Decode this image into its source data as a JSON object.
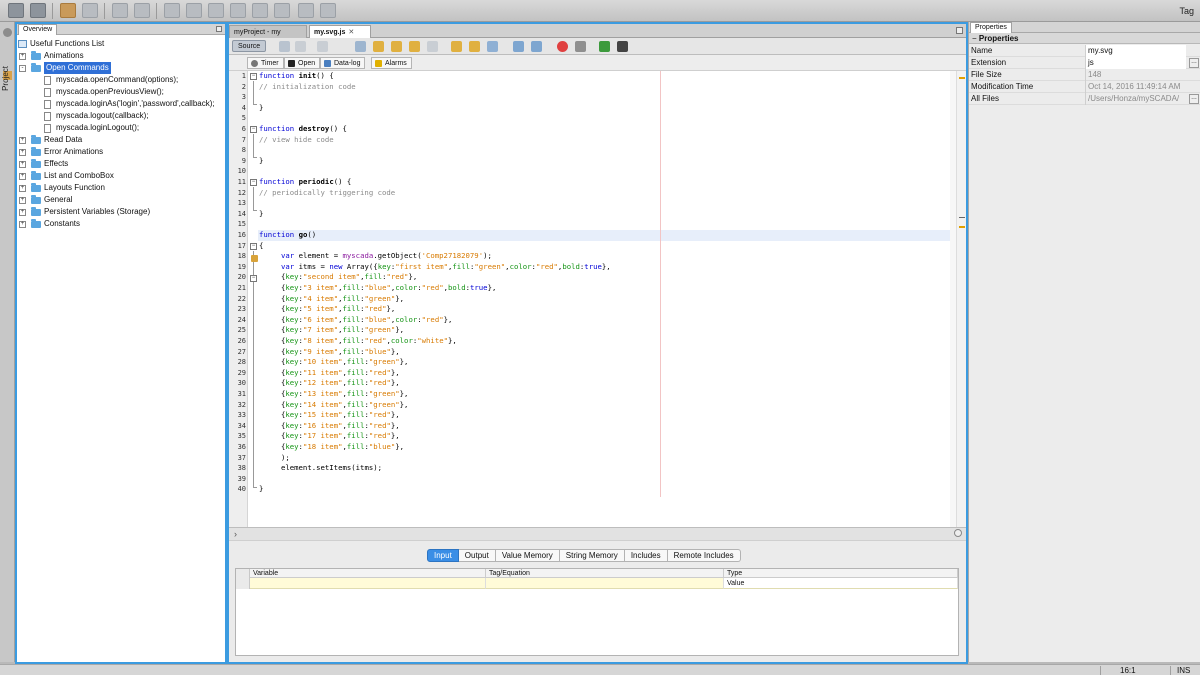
{
  "toolbar": {
    "tag_label": "Tag",
    "icons": [
      "save-icon",
      "save-all-icon",
      "undo-icon",
      "redo-icon",
      "copy-page-icon",
      "delete-page-icon",
      "screen-icon",
      "screen-add-icon",
      "screen-move-icon",
      "screen-remove-icon",
      "screen-copy-icon",
      "screen-export-icon",
      "print-icon",
      "download-icon"
    ]
  },
  "left_strip": {
    "project_label": "Project"
  },
  "overview": {
    "tab_label": "Overview",
    "root": "Useful Functions List",
    "items": [
      {
        "label": "Animations",
        "expander": "+"
      },
      {
        "label": "Open Commands",
        "expander": "-"
      },
      {
        "label": "Read Data",
        "expander": "+"
      },
      {
        "label": "Error Animations",
        "expander": "+"
      },
      {
        "label": "Effects",
        "expander": "+"
      },
      {
        "label": "List and ComboBox",
        "expander": "+"
      },
      {
        "label": "Layouts Function",
        "expander": "+"
      },
      {
        "label": "General",
        "expander": "+"
      },
      {
        "label": "Persistent Variables (Storage)",
        "expander": "+"
      },
      {
        "label": "Constants",
        "expander": "+"
      }
    ],
    "open_commands_children": [
      "myscada.openCommand(options);",
      "myscada.openPreviousView();",
      "myscada.loginAs('login','password',callback);",
      "myscada.logout(callback);",
      "myscada.loginLogout();"
    ]
  },
  "editor": {
    "tabs": [
      {
        "label": "myProject - my"
      },
      {
        "label": "my.svg.js",
        "close": "✕"
      }
    ],
    "source_label": "Source",
    "sub_buttons": [
      "Timer",
      "Open",
      "Data-log",
      "Alarms"
    ],
    "line_numbers": [
      "1",
      "2",
      "3",
      "4",
      "5",
      "6",
      "7",
      "8",
      "9",
      "10",
      "11",
      "12",
      "13",
      "14",
      "15",
      "16",
      "17",
      "18",
      "19",
      "20",
      "21",
      "22",
      "23",
      "24",
      "25",
      "26",
      "27",
      "28",
      "29",
      "30",
      "31",
      "32",
      "33",
      "34",
      "35",
      "36",
      "37",
      "38",
      "39",
      "40"
    ],
    "code": {
      "l1_kw": "function",
      "l1_fn": "init",
      "l1_rest": "() {",
      "l2": "// initialization code",
      "l4": "}",
      "l6_kw": "function",
      "l6_fn": "destroy",
      "l6_rest": "() {",
      "l7": "// view hide code",
      "l9": "}",
      "l11_kw": "function",
      "l11_fn": "periodic",
      "l11_rest": "() {",
      "l12": "// periodically triggering code",
      "l14": "}",
      "l16_kw": "function",
      "l16_fn": "go",
      "l16_rest": "()",
      "l17": "{",
      "l18_kw": "var",
      "l18_a": "element = ",
      "l18_obj": "myscada",
      "l18_b": ".getObject(",
      "l18_str": "'Comp27182079'",
      "l18_c": ");",
      "l19_kw": "var",
      "l19_a": "itms = ",
      "l19_new": "new",
      "l19_b": "Array({",
      "l19_k1": "key",
      "l19_v1": "\"first item\"",
      "l19_k2": "fill",
      "l19_v2": "\"green\"",
      "l19_k3": "color",
      "l19_v3": "\"red\"",
      "l19_k4": "bold",
      "l19_v4": "true",
      "l19_end": "},",
      "items": [
        {
          "key": "\"second item\"",
          "fill": "\"red\""
        },
        {
          "key": "\"3 item\"",
          "fill": "\"blue\"",
          "color": "\"red\"",
          "bold": "true"
        },
        {
          "key": "\"4 item\"",
          "fill": "\"green\""
        },
        {
          "key": "\"5 item\"",
          "fill": "\"red\""
        },
        {
          "key": "\"6 item\"",
          "fill": "\"blue\"",
          "color": "\"red\""
        },
        {
          "key": "\"7 item\"",
          "fill": "\"green\""
        },
        {
          "key": "\"8 item\"",
          "fill": "\"red\"",
          "color": "\"white\""
        },
        {
          "key": "\"9 item\"",
          "fill": "\"blue\""
        },
        {
          "key": "\"10 item\"",
          "fill": "\"green\""
        },
        {
          "key": "\"11 item\"",
          "fill": "\"red\""
        },
        {
          "key": "\"12 item\"",
          "fill": "\"red\""
        },
        {
          "key": "\"13 item\"",
          "fill": "\"green\""
        },
        {
          "key": "\"14 item\"",
          "fill": "\"green\""
        },
        {
          "key": "\"15 item\"",
          "fill": "\"red\""
        },
        {
          "key": "\"16 item\"",
          "fill": "\"red\""
        },
        {
          "key": "\"17 item\"",
          "fill": "\"red\""
        },
        {
          "key": "\"18 item\"",
          "fill": "\"blue\""
        }
      ],
      "l37": ");",
      "l38": "element.setItems(itms);",
      "l40": "}"
    }
  },
  "bottom": {
    "tabs": [
      "Input",
      "Output",
      "Value Memory",
      "String Memory",
      "Includes",
      "Remote Includes"
    ],
    "active_tab": "Input",
    "columns": [
      "Variable",
      "Tag/Equation",
      "Type"
    ],
    "row": {
      "variable": "",
      "tag": "",
      "type": "Value"
    }
  },
  "properties": {
    "tab_label": "Properties",
    "header": "Properties",
    "rows": [
      {
        "key": "Name",
        "value": "my.svg"
      },
      {
        "key": "Extension",
        "value": "js"
      },
      {
        "key": "File Size",
        "value": "148"
      },
      {
        "key": "Modification Time",
        "value": "Oct 14, 2016 11:49:14 AM"
      },
      {
        "key": "All Files",
        "value": "/Users/Honza/mySCADA/"
      }
    ]
  },
  "status": {
    "caret": "16:1",
    "mode": "INS"
  },
  "colors": {
    "accent": "#3b9be0",
    "selection": "#2f6fd6",
    "keyword": "#0000d6",
    "string": "#d87a00"
  }
}
